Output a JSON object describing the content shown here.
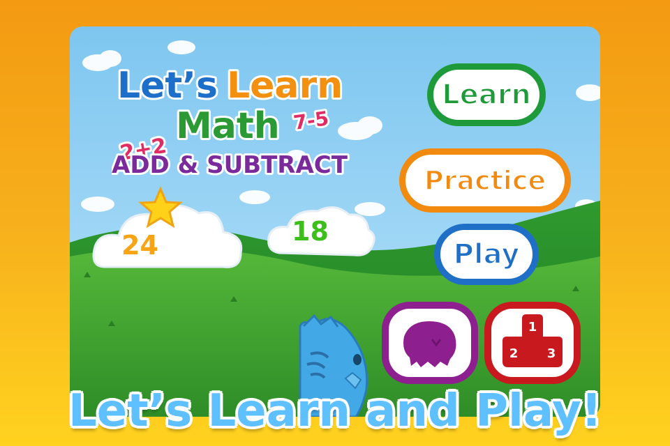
{
  "title": {
    "line1_word1": "Let’s",
    "line1_word2": "Learn",
    "line2": "Math",
    "sum_left": "2+2",
    "sum_right": "7-5",
    "subtitle": "ADD & SUBTRACT"
  },
  "scores": {
    "stars": "24",
    "second": "18"
  },
  "menu": {
    "learn": "Learn",
    "practice": "Practice",
    "play": "Play"
  },
  "leaderboard": {
    "first": "1",
    "second": "2",
    "third": "3"
  },
  "banner": "Let’s Learn and Play!",
  "colors": {
    "learn": "#1f9a3a",
    "practice": "#f18a0f",
    "play": "#1f6fc7",
    "monster": "#8e1f8f",
    "leaderboard": "#c8191f",
    "banner_text": "#5ec0ff"
  },
  "icons": [
    "star-icon",
    "monster-icon",
    "podium-icon",
    "blue-mascot"
  ]
}
